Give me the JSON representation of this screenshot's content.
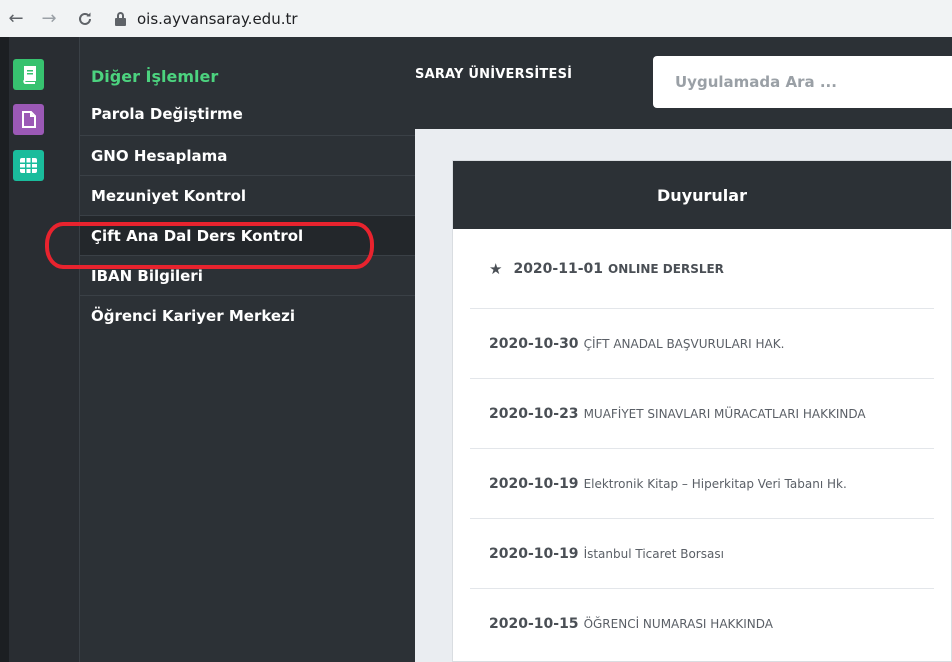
{
  "browser": {
    "url": "ois.ayvansaray.edu.tr"
  },
  "menu": {
    "heading": "Diğer İşlemler",
    "items": [
      {
        "label": "Parola Değiştirme"
      },
      {
        "label": "GNO Hesaplama"
      },
      {
        "label": "Mezuniyet Kontrol"
      },
      {
        "label": "Çift Ana Dal Ders Kontrol"
      },
      {
        "label": "IBAN Bilgileri"
      },
      {
        "label": "Öğrenci Kariyer Merkezi"
      }
    ]
  },
  "header": {
    "university": "SARAY ÜNİVERSİTESİ",
    "search_placeholder": "Uygulamada Ara ..."
  },
  "announcements": {
    "title": "Duyurular",
    "items": [
      {
        "date": "2020-11-01",
        "title": "ONLINE DERSLER",
        "starred": true
      },
      {
        "date": "2020-10-30",
        "title": "ÇİFT ANADAL BAŞVURULARI HAK."
      },
      {
        "date": "2020-10-23",
        "title": "MUAFİYET SINAVLARI MÜRACATLARI HAKKINDA"
      },
      {
        "date": "2020-10-19",
        "title": "Elektronik Kitap – Hiperkitap Veri Tabanı Hk."
      },
      {
        "date": "2020-10-19",
        "title": "İstanbul Ticaret Borsası"
      },
      {
        "date": "2020-10-15",
        "title": "ÖĞRENCİ NUMARASI HAKKINDA"
      }
    ]
  },
  "colors": {
    "menu_heading": "#4cd37f",
    "highlight_annotation": "#e8232e",
    "rail_green": "#37c26f",
    "rail_purple": "#9b59b6",
    "rail_teal": "#1abc9c"
  }
}
